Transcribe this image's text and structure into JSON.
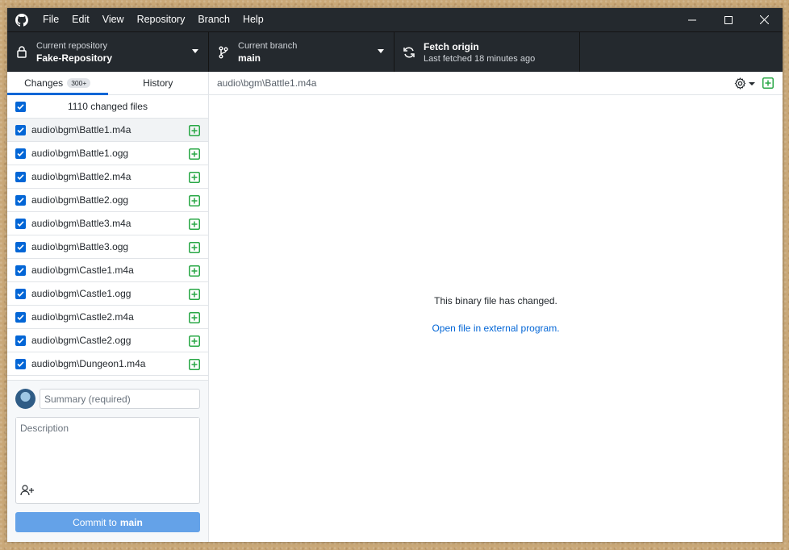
{
  "menu": [
    "File",
    "Edit",
    "View",
    "Repository",
    "Branch",
    "Help"
  ],
  "toolbar": {
    "repo_label": "Current repository",
    "repo_value": "Fake-Repository",
    "branch_label": "Current branch",
    "branch_value": "main",
    "fetch_title": "Fetch origin",
    "fetch_sub": "Last fetched 18 minutes ago"
  },
  "tabs": {
    "changes": "Changes",
    "changes_count": "300+",
    "history": "History"
  },
  "select_all_label": "1110 changed files",
  "files": [
    "audio\\bgm\\Battle1.m4a",
    "audio\\bgm\\Battle1.ogg",
    "audio\\bgm\\Battle2.m4a",
    "audio\\bgm\\Battle2.ogg",
    "audio\\bgm\\Battle3.m4a",
    "audio\\bgm\\Battle3.ogg",
    "audio\\bgm\\Castle1.m4a",
    "audio\\bgm\\Castle1.ogg",
    "audio\\bgm\\Castle2.m4a",
    "audio\\bgm\\Castle2.ogg",
    "audio\\bgm\\Dungeon1.m4a"
  ],
  "commit": {
    "summary_placeholder": "Summary (required)",
    "description_placeholder": "Description",
    "button_prefix": "Commit to",
    "button_branch": "main"
  },
  "content": {
    "path": "audio\\bgm\\Battle1.m4a",
    "message": "This binary file has changed.",
    "link": "Open file in external program."
  },
  "colors": {
    "titlebar": "#24292e",
    "accent": "#0366d6",
    "added": "#28a745",
    "commit_button": "#64a2e8"
  }
}
